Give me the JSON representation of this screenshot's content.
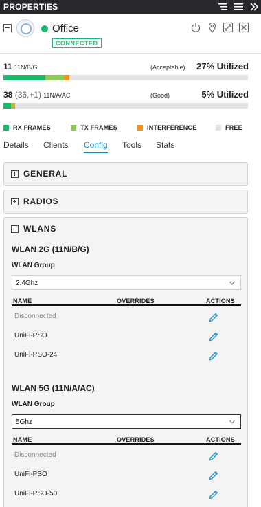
{
  "header": {
    "title": "PROPERTIES"
  },
  "device": {
    "name": "Office",
    "status": "CONNECTED",
    "status_color": "#1db76a"
  },
  "radios": [
    {
      "channel": "11",
      "channel_extra": "",
      "mode": "11N/B/G",
      "quality": "(Acceptable)",
      "utilization_label": "27% Utilized",
      "rx_frames": 0.17,
      "tx_frames": 0.08,
      "interference": 0.02
    },
    {
      "channel": "38",
      "channel_extra": " (36,+1)",
      "mode": "11N/A/AC",
      "quality": "(Good)",
      "utilization_label": "5% Utilized",
      "rx_frames": 0.03,
      "tx_frames": 0.01,
      "interference": 0.005
    }
  ],
  "legend": [
    {
      "label": "RX FRAMES",
      "color": "#1db76a"
    },
    {
      "label": "TX FRAMES",
      "color": "#8fc95a"
    },
    {
      "label": "INTERFERENCE",
      "color": "#f5931f"
    },
    {
      "label": "FREE",
      "color": "#e3e3e3"
    }
  ],
  "tabs": [
    {
      "label": "Details",
      "active": false
    },
    {
      "label": "Clients",
      "active": false
    },
    {
      "label": "Config",
      "active": true
    },
    {
      "label": "Tools",
      "active": false
    },
    {
      "label": "Stats",
      "active": false
    }
  ],
  "panels": {
    "general": "GENERAL",
    "radios": "RADIOS",
    "wlans": "WLANS"
  },
  "wlan_2g": {
    "title": "WLAN 2G (11N/B/G)",
    "group_label": "WLAN Group",
    "group_value": "2.4Ghz",
    "columns": [
      "NAME",
      "OVERRIDES",
      "ACTIONS"
    ],
    "rows": [
      {
        "name": "Disconnected",
        "muted": true
      },
      {
        "name": "UniFi-PSO",
        "muted": false
      },
      {
        "name": "UniFi-PSO-24",
        "muted": false
      }
    ]
  },
  "wlan_5g": {
    "title": "WLAN 5G (11N/A/AC)",
    "group_label": "WLAN Group",
    "group_value": "5Ghz",
    "columns": [
      "NAME",
      "OVERRIDES",
      "ACTIONS"
    ],
    "rows": [
      {
        "name": "Disconnected",
        "muted": true
      },
      {
        "name": "UniFi-PSO",
        "muted": false
      },
      {
        "name": "UniFi-PSO-50",
        "muted": false
      }
    ]
  },
  "accent_color": "#0d8bd0"
}
